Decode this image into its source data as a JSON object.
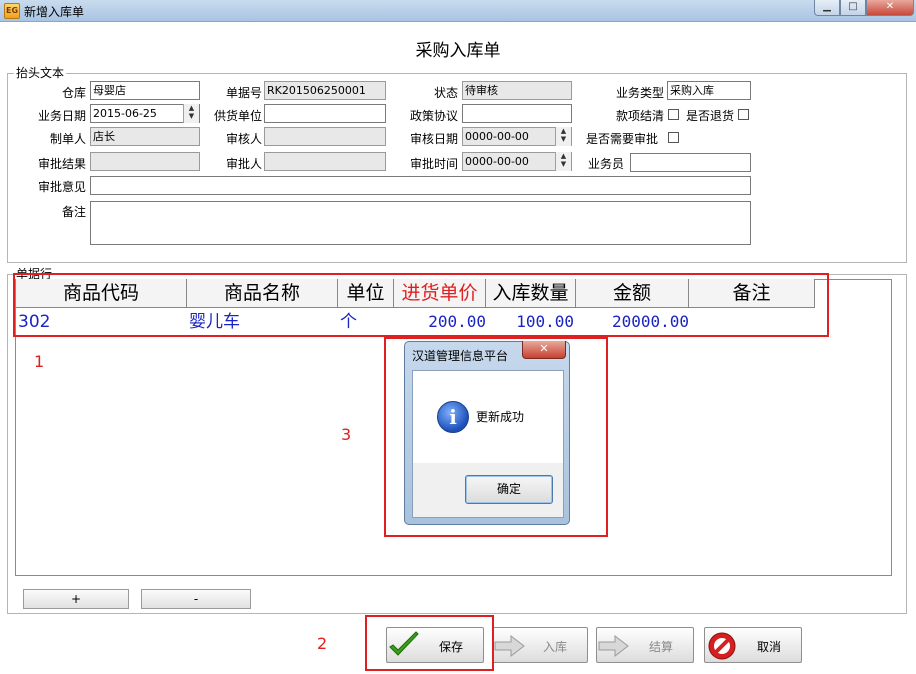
{
  "window": {
    "title": "新增入库单",
    "icon_label": "EG"
  },
  "form_title": "采购入库单",
  "header_group": {
    "legend": "抬头文本",
    "warehouse": {
      "label": "仓库",
      "value": "母婴店"
    },
    "doc_no": {
      "label": "单据号",
      "value": "RK201506250001"
    },
    "status": {
      "label": "状态",
      "value": "待审核"
    },
    "biz_type": {
      "label": "业务类型",
      "value": "采购入库"
    },
    "biz_date": {
      "label": "业务日期",
      "value": "2015-06-25"
    },
    "supplier": {
      "label": "供货单位",
      "value": ""
    },
    "policy": {
      "label": "政策协议",
      "value": ""
    },
    "paid_off": {
      "label": "款项结清"
    },
    "is_return": {
      "label": "是否退货"
    },
    "creator": {
      "label": "制单人",
      "value": "店长"
    },
    "auditor": {
      "label": "审核人",
      "value": ""
    },
    "audit_date": {
      "label": "审核日期",
      "value": "0000-00-00"
    },
    "need_approval": {
      "label": "是否需要审批"
    },
    "approval_result": {
      "label": "审批结果",
      "value": ""
    },
    "approver": {
      "label": "审批人",
      "value": ""
    },
    "approval_time": {
      "label": "审批时间",
      "value": "0000-00-00"
    },
    "salesman": {
      "label": "业务员",
      "value": ""
    },
    "approval_opinion": {
      "label": "审批意见",
      "value": ""
    },
    "remark": {
      "label": "备注",
      "value": ""
    }
  },
  "detail_group": {
    "legend": "单据行",
    "columns": [
      "商品代码",
      "商品名称",
      "单位",
      "进货单价",
      "入库数量",
      "金额",
      "备注"
    ],
    "rows": [
      {
        "code": "302",
        "name": "婴儿车",
        "unit": "个",
        "price": "200.00",
        "qty": "100.00",
        "amount": "20000.00",
        "remark": ""
      }
    ],
    "add_label": "+",
    "remove_label": "-"
  },
  "actions": {
    "save": "保存",
    "stock_in": "入库",
    "settle": "结算",
    "cancel": "取消"
  },
  "dialog": {
    "title": "汉道管理信息平台",
    "message": "更新成功",
    "ok": "确定"
  },
  "annotations": {
    "a1": "1",
    "a2": "2",
    "a3": "3"
  },
  "colors": {
    "highlight": "#e02020",
    "row_text": "#1a24c4",
    "price_header": "#e02020"
  }
}
